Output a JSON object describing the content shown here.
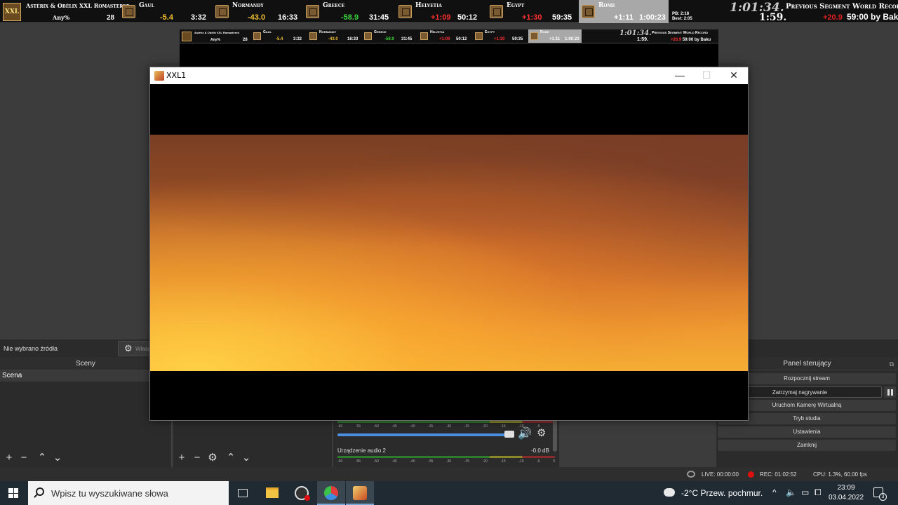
{
  "splits": {
    "game_icon_text": "XXL",
    "game_title": "Astérix & Obélix XXL Romastered",
    "category": "Any%",
    "attempts": "28",
    "segments": [
      {
        "name": "Gaul",
        "delta": "-5.4",
        "delta_color": "yellow",
        "time": "3:32"
      },
      {
        "name": "Normandy",
        "delta": "-43.0",
        "delta_color": "yellow",
        "time": "16:33"
      },
      {
        "name": "Greece",
        "delta": "-58.9",
        "delta_color": "green",
        "time": "31:45"
      },
      {
        "name": "Helvetia",
        "delta": "+1:09",
        "delta_color": "red",
        "time": "50:12"
      },
      {
        "name": "Egypt",
        "delta": "+1:30",
        "delta_color": "red",
        "time": "59:35"
      },
      {
        "name": "Rome",
        "delta": "+1:11",
        "delta_color": "white",
        "time": "1:00:23",
        "active": true
      }
    ],
    "timer": "1:01:34.",
    "segment_timer": "1:59.",
    "pb_label": "PB:",
    "pb_value": "2:18",
    "best_label": "Best:",
    "best_value": "2:05",
    "wr_title": "Previous Segment World Record",
    "wr_delta": "+20.9",
    "wr_time": "59:00 by Baku"
  },
  "obs": {
    "no_source": "Nie wybrano źródła",
    "properties_label": "Właściwości",
    "scenes_header": "Sceny",
    "scene_item": "Scena",
    "mixer_ticks": [
      "-60",
      "-55",
      "-50",
      "-45",
      "-40",
      "-35",
      "-30",
      "-25",
      "-20",
      "-15",
      "-10",
      "-5",
      "0"
    ],
    "audio2_label": "Urządzenie audio 2",
    "audio2_db": "-0.0 dB",
    "controls_header": "Panel sterujący",
    "controls": [
      "Rozpocznij stream",
      "Zatrzymaj nagrywanie",
      "Uruchom Kamerę Wirtualną",
      "Tryb studia",
      "Ustawienia",
      "Zamknij"
    ],
    "live": "LIVE: 00:00:00",
    "rec": "REC: 01:02:52",
    "cpu": "CPU: 1.3%, 60.00 fps"
  },
  "window": {
    "title": "XXL1",
    "minimize": "—",
    "maximize": "☐",
    "close": "✕"
  },
  "taskbar": {
    "search_placeholder": "Wpisz tu wyszukiwane słowa",
    "weather": "-2°C  Przew. pochmur.",
    "time": "23:09",
    "date": "03.04.2022",
    "notifications": "3"
  },
  "colors": {
    "green": "#3ad53a",
    "yellow": "#f0c030",
    "red": "#ff3030",
    "active_segment": "#a8a8a8"
  }
}
